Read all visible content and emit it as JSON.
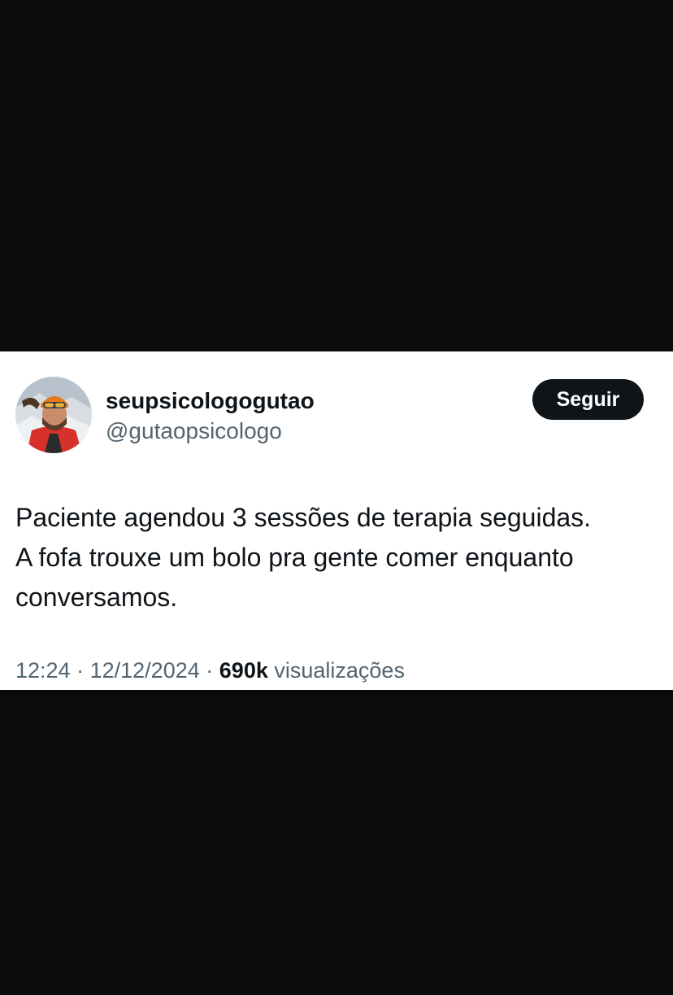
{
  "tweet": {
    "display_name": "seupsicologogutao",
    "handle": "@gutaopsicologo",
    "follow_label": "Seguir",
    "text_lines": [
      "Paciente agendou 3 sessões de terapia seguidas.",
      "A fofa trouxe um bolo pra gente comer enquanto",
      "conversamos."
    ],
    "time": "12:24",
    "separator": "·",
    "date": "12/12/2024",
    "views_count": "690k",
    "views_label": "visualizações"
  },
  "colors": {
    "background_band": "#0b0b0c",
    "card": "#ffffff",
    "text_primary": "#0f1419",
    "text_secondary": "#536471",
    "follow_button": "#0f1419"
  }
}
